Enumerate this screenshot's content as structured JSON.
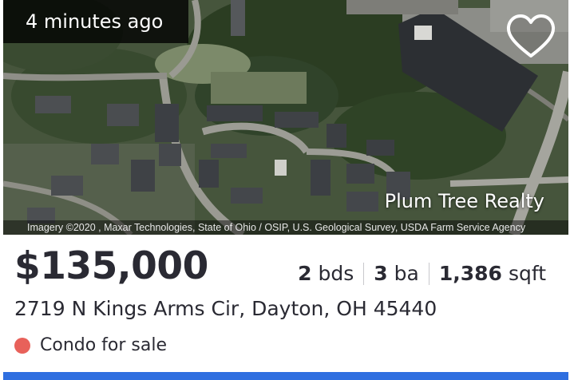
{
  "listing": {
    "time_posted": "4 minutes ago",
    "favorite_icon": "heart-outline-icon",
    "brokerage": "Plum Tree Realty",
    "image_attribution": "Imagery ©2020 , Maxar Technologies, State of Ohio / OSIP, U.S. Geological Survey, USDA Farm Service Agency",
    "price": "$135,000",
    "beds_value": "2",
    "beds_unit": "bds",
    "baths_value": "3",
    "baths_unit": "ba",
    "sqft_value": "1,386",
    "sqft_unit": "sqft",
    "address": "2719 N Kings Arms Cir, Dayton, OH 45440",
    "status": "Condo for sale",
    "status_color": "#e8615a",
    "accent_color": "#2f6fe0"
  }
}
